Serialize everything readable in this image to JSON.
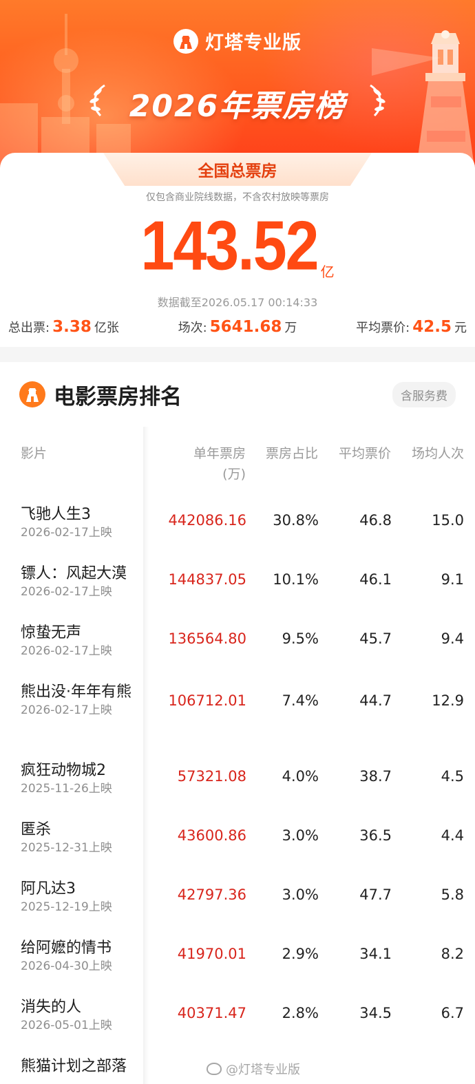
{
  "header": {
    "brand": "灯塔专业版",
    "title": "2026年票房榜"
  },
  "summary": {
    "tab": "全国总票房",
    "note": "仅包含商业院线数据，不含农村放映等票房",
    "total": "143.52",
    "total_unit": "亿",
    "as_of": "数据截至2026.05.17 00:14:33",
    "tickets_label": "总出票:",
    "tickets_value": "3.38",
    "tickets_unit": "亿张",
    "shows_label": "场次:",
    "shows_value": "5641.68",
    "shows_unit": "万",
    "price_label": "平均票价:",
    "price_value": "42.5",
    "price_unit": "元"
  },
  "ranking": {
    "title": "电影票房排名",
    "fee_badge": "含服务费",
    "columns": {
      "film": "影片",
      "gross": "单年票房",
      "gross_unit": "(万)",
      "share": "票房占比",
      "price": "平均票价",
      "avg": "场均人次"
    },
    "rows": [
      {
        "name": "飞驰人生3",
        "date": "2026-02-17上映",
        "gross": "442086.16",
        "share": "30.8%",
        "price": "46.8",
        "avg": "15.0"
      },
      {
        "name": "镖人：风起大漠",
        "date": "2026-02-17上映",
        "gross": "144837.05",
        "share": "10.1%",
        "price": "46.1",
        "avg": "9.1"
      },
      {
        "name": "惊蛰无声",
        "date": "2026-02-17上映",
        "gross": "136564.80",
        "share": "9.5%",
        "price": "45.7",
        "avg": "9.4"
      },
      {
        "name": "熊出没·年年有熊",
        "date": "2026-02-17上映",
        "gross": "106712.01",
        "share": "7.4%",
        "price": "44.7",
        "avg": "12.9"
      },
      {
        "name": "疯狂动物城2",
        "date": "2025-11-26上映",
        "gross": "57321.08",
        "share": "4.0%",
        "price": "38.7",
        "avg": "4.5"
      },
      {
        "name": "匿杀",
        "date": "2025-12-31上映",
        "gross": "43600.86",
        "share": "3.0%",
        "price": "36.5",
        "avg": "4.4"
      },
      {
        "name": "阿凡达3",
        "date": "2025-12-19上映",
        "gross": "42797.36",
        "share": "3.0%",
        "price": "47.7",
        "avg": "5.8"
      },
      {
        "name": "给阿嬷的情书",
        "date": "2026-04-30上映",
        "gross": "41970.01",
        "share": "2.9%",
        "price": "34.1",
        "avg": "8.2"
      },
      {
        "name": "消失的人",
        "date": "2026-05-01上映",
        "gross": "40371.47",
        "share": "2.8%",
        "price": "34.5",
        "avg": "6.7"
      },
      {
        "name": "熊猫计划之部落",
        "date": "",
        "gross": "",
        "share": "",
        "price": "",
        "avg": ""
      }
    ]
  },
  "watermark": "@灯塔专业版"
}
